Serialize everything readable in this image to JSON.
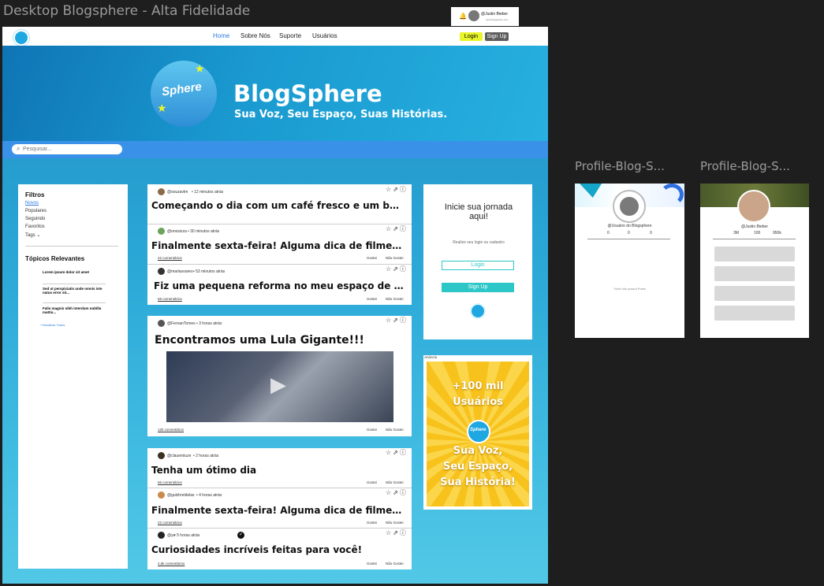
{
  "canvas": {
    "title": "Desktop Blogsphere - Alta Fidelidade",
    "user_chip": "@Justin Bieber",
    "user_chip_sub": "www.blogsphere.com"
  },
  "nav": {
    "home": "Home",
    "about": "Sobre Nós",
    "support": "Suporte",
    "users": "Usuários",
    "login": "Login",
    "signup": "Sign Up"
  },
  "hero": {
    "logo_text": "Sphere",
    "title": "BlogSphere",
    "subtitle": "Sua Voz, Seu Espaço, Suas Histórias."
  },
  "search": {
    "placeholder": "Pesquisar..."
  },
  "filters": {
    "title": "Filtros",
    "items": [
      "Novos",
      "Populares",
      "Seguindo",
      "Favoritos",
      "Tags"
    ],
    "topics_title": "Tópicos Relevantes",
    "topics": [
      {
        "title": "Lorem ipsum dolor sit amet"
      },
      {
        "title": "Sed ut perspiciatis unde omnis iste natus error sit..."
      },
      {
        "title": "Falis magnis nibh interdum nubilla mattis..."
      }
    ],
    "see_all": "+Visualizar Todos"
  },
  "posts": [
    {
      "user": "@souzavtm",
      "time": "• 12 minutos atrás",
      "title": "Começando o dia com um café fresco e um bom livro.",
      "comments": "",
      "like": "",
      "dislike": ""
    },
    {
      "user": "@onosizza",
      "time": "• 30 minutos atrás",
      "title": "Finalmente sexta-feira! Alguma dica de filme para...",
      "comments": "22 comentários",
      "like": "Gostei",
      "dislike": "Não Gostei"
    },
    {
      "user": "@marlasoares",
      "time": "• 53 minutos atrás",
      "title": "Fiz uma pequena reforma no meu espaço de traba...",
      "comments": "58 comentários",
      "like": "Gostei",
      "dislike": "Não Gostei"
    },
    {
      "user": "@FernanTomes",
      "time": "• 3 horas atrás",
      "title": "Encontramos uma Lula Gigante!!!",
      "comments": "12k comentários",
      "like": "Gostei",
      "dislike": "Não Gostei"
    },
    {
      "user": "@clauemiuze",
      "time": "• 2 horas atrás",
      "title": "Tenha um ótimo dia",
      "comments": "56 comentários",
      "like": "Gostei",
      "dislike": "Não Gostei"
    },
    {
      "user": "@gulzhreldelas",
      "time": "• 4 horas atrás",
      "title": "Finalmente sexta-feira! Alguma dica de filme para...",
      "comments": "22 comentários",
      "like": "Gostei",
      "dislike": "Não Gostei"
    },
    {
      "user": "@ye",
      "time": "• 5 horas atrás",
      "title": "Curiosidades incríveis feitas para você!",
      "comments": "4,6k comentários",
      "like": "Gostei",
      "dislike": "Não Gostei"
    }
  ],
  "login_panel": {
    "title": "Inicie sua jornada aqui!",
    "text": "Realize seu login ou cadastro",
    "login": "Login",
    "signup": "Sign Up"
  },
  "ad": {
    "label": "Anúncio",
    "line1": "+100 mil",
    "line2": "Usuários",
    "logo": "Sphere",
    "line3": "Sua Voz,",
    "line4": "Seu Espaço,",
    "line5": "Sua História!"
  },
  "profile1": {
    "title": "Profile-Blog-S...",
    "user": "@Usuário do Blogsphere",
    "stats": [
      "0",
      "0",
      "0"
    ],
    "empty": "Você não possui Posts"
  },
  "profile2": {
    "title": "Profile-Blog-S...",
    "user": "@Justin Bieber",
    "stats": [
      "3M",
      "100",
      "950k"
    ]
  }
}
